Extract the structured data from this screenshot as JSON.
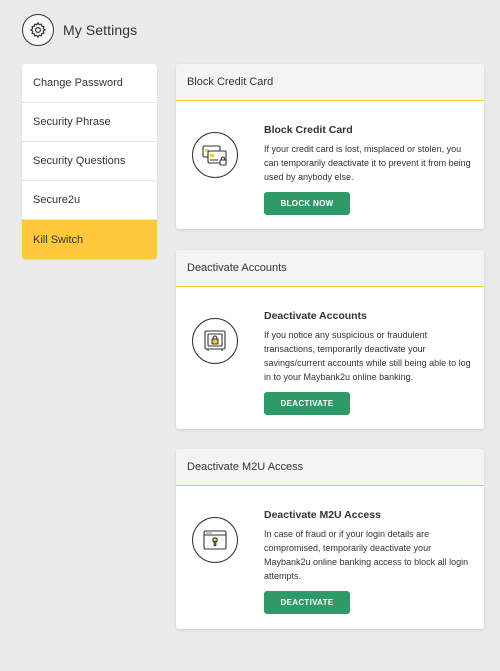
{
  "header": {
    "title": "My Settings",
    "icon": "gear-icon"
  },
  "sidebar": {
    "items": [
      {
        "label": "Change Password"
      },
      {
        "label": "Security Phrase"
      },
      {
        "label": "Security Questions"
      },
      {
        "label": "Secure2u"
      },
      {
        "label": "Kill Switch",
        "active": true
      }
    ]
  },
  "cards": [
    {
      "header": "Block Credit Card",
      "title": "Block Credit Card",
      "description": "If your credit card is lost, misplaced or stolen, you can temporarily deactivate it to prevent it from being used by anybody else.",
      "button": "BLOCK NOW",
      "icon": "credit-cards-lock-icon"
    },
    {
      "header": "Deactivate Accounts",
      "title": "Deactivate Accounts",
      "description": "If you notice any suspicious or fraudulent transactions, temporarily deactivate your savings/current accounts while still being able to log in to your Maybank2u online banking.",
      "button": "DEACTIVATE",
      "icon": "safe-lock-icon"
    },
    {
      "header": "Deactivate M2U Access",
      "title": "Deactivate M2U Access",
      "description": "In case of fraud or if your login details are compromised, temporarily deactivate your Maybank2u online banking access to block all login attempts.",
      "button": "DEACTIVATE",
      "icon": "browser-password-icon"
    }
  ],
  "colors": {
    "accent": "#ffc83d",
    "button": "#2f9a68",
    "background": "#ebebeb"
  }
}
